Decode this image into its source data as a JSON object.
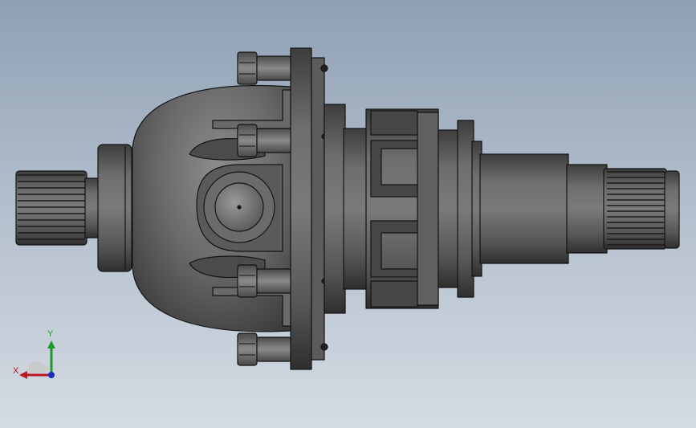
{
  "viewport": {
    "background_top": "#8fa0b4",
    "background_bottom": "#d4dbe3",
    "part_color": "#5f5f5f",
    "edge_color": "#141414"
  },
  "triad": {
    "x_label": "X",
    "y_label": "Y",
    "x_color": "#c0141e",
    "y_color": "#1d9a2a",
    "z_color": "#1a2cc8"
  }
}
